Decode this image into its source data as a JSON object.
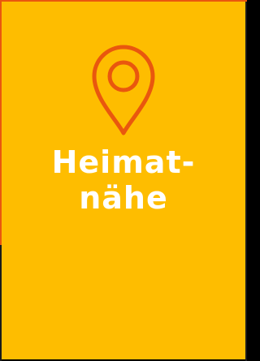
{
  "card": {
    "title_line1": "Heimat-",
    "title_line2": "nähe",
    "icon": "map-pin-icon",
    "background_color": "#FEBD00",
    "accent_color": "#E9570E",
    "text_color": "#FFFFFF"
  }
}
